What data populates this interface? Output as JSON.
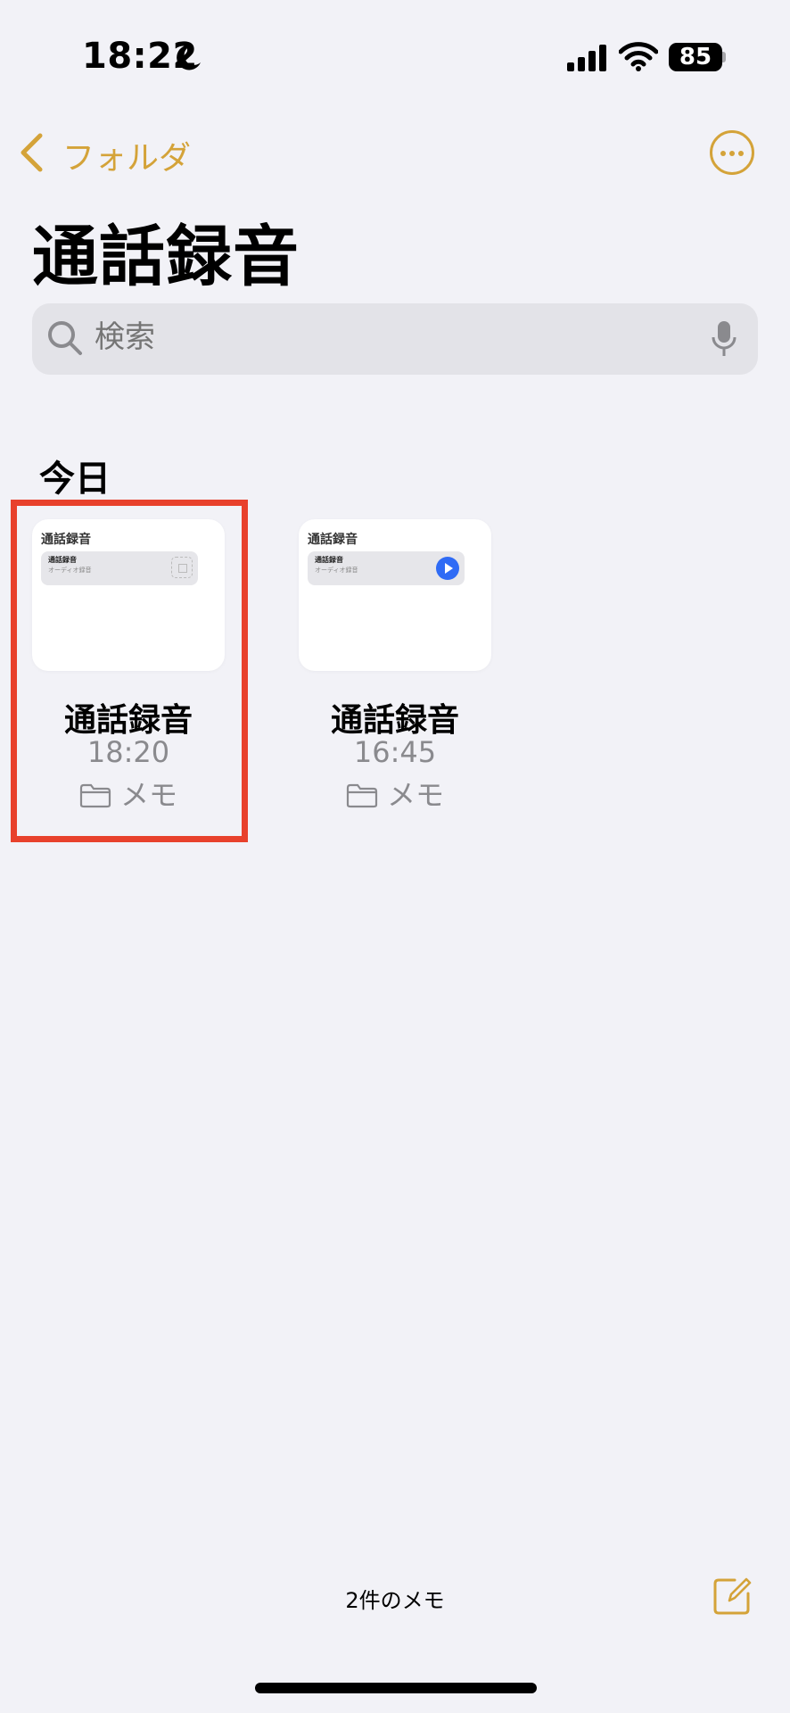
{
  "status_bar": {
    "time": "18:22",
    "battery": "85"
  },
  "nav": {
    "back_label": "フォルダ"
  },
  "page": {
    "title": "通話録音"
  },
  "search": {
    "placeholder": "検索"
  },
  "section": {
    "title": "今日"
  },
  "notes": [
    {
      "thumb_title": "通話録音",
      "attachment_title": "通話録音",
      "attachment_subtitle": "オーディオ録音",
      "title": "通話録音",
      "time": "18:20",
      "folder": "メモ"
    },
    {
      "thumb_title": "通話録音",
      "attachment_title": "通話録音",
      "attachment_subtitle": "オーディオ録音",
      "title": "通話録音",
      "time": "16:45",
      "folder": "メモ"
    }
  ],
  "footer": {
    "note_count": "2件のメモ"
  },
  "colors": {
    "accent": "#d4a339",
    "highlight": "#e8412c",
    "play": "#2f6bf5",
    "background": "#f2f2f7"
  }
}
